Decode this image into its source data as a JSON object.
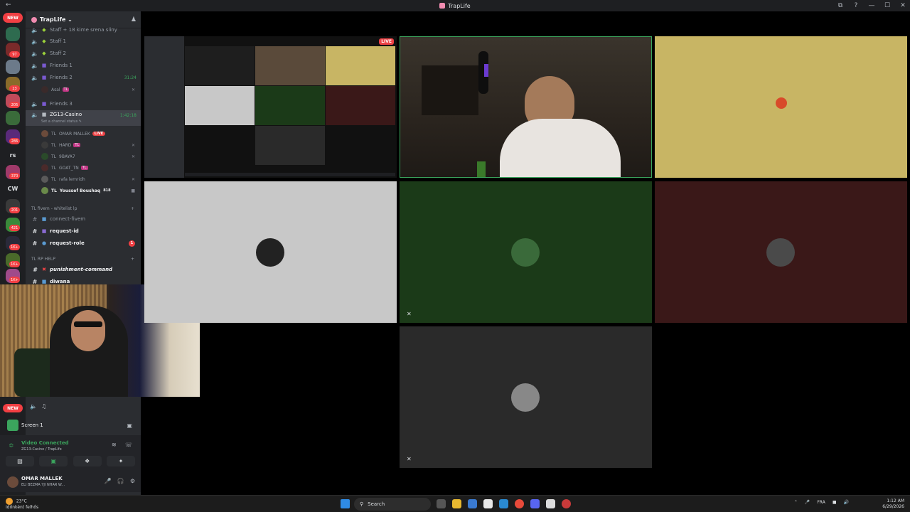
{
  "window": {
    "title": "TrapLife",
    "back": "←",
    "controls": [
      "⧉",
      "?",
      "—",
      "☐",
      "✕"
    ]
  },
  "rail": {
    "new_badge": "NEW",
    "counts": [
      "97",
      "23",
      "205",
      "286",
      "370",
      "201",
      "421",
      "1K+",
      "1K+",
      "1K+"
    ],
    "text_servers": [
      "rs",
      "CW"
    ],
    "new_badge_2": "NEW"
  },
  "server": {
    "name": "TrapLife ⌄",
    "invite_icon": "add-member-icon"
  },
  "channels": [
    {
      "label": "Staff + 18 kime srena sliny",
      "icon": "speaker-icon",
      "right": ""
    },
    {
      "label": "Staff 1",
      "icon": "speaker-icon",
      "right": ""
    },
    {
      "label": "Staff 2",
      "icon": "speaker-icon",
      "right": ""
    },
    {
      "label": "Friends 1",
      "icon": "speaker-icon",
      "right": ""
    },
    {
      "label": "Friends 2",
      "icon": "speaker-icon",
      "right": "31:24"
    }
  ],
  "friends2_user": {
    "name": "Asal",
    "tag": "TL"
  },
  "friends3": {
    "label": "Friends 3"
  },
  "active_channel": {
    "label": "ZG13-Casino",
    "time": "1:42:18",
    "status": "Set a channel status ✎"
  },
  "voice_users": [
    {
      "prefix": "TL",
      "name": "OMAR MALLEK",
      "live": "LIVE"
    },
    {
      "prefix": "TL",
      "name": "HARD",
      "tag": "TL"
    },
    {
      "prefix": "TL",
      "name": "9BAYA7",
      "tag": ""
    },
    {
      "prefix": "TL",
      "name": "GOAT_TN",
      "tag": "TL"
    },
    {
      "prefix": "TL",
      "name": "rafa lemridh",
      "tag": ""
    },
    {
      "prefix": "TL",
      "name": "Youssef Boushaq",
      "tag": "818"
    }
  ],
  "categories": [
    {
      "label": "TL fivem - whitelist lp",
      "plus": "+"
    },
    {
      "label": "TL RP HELP",
      "plus": "+"
    }
  ],
  "text_channels": [
    {
      "label": "connect-fivem"
    },
    {
      "label": "request-id"
    },
    {
      "label": "request-role",
      "badge": "1"
    }
  ],
  "help_channels": [
    {
      "label": "punishment-command"
    },
    {
      "label": "diwana"
    }
  ],
  "voice_panel": {
    "screen_label": "Screen 1",
    "connected": "Video Connected",
    "location": "ZG13-Casino / TrapLife",
    "user_name": "OMAR MALLEK",
    "user_status": "ELI BEZMA YJI NHAR W..."
  },
  "grid": {
    "live_label": "LIVE",
    "tiles": [
      {
        "name": "stream",
        "bg": "#111111"
      },
      {
        "name": "camera-omar",
        "bg": "#2a241e"
      },
      {
        "name": "tile-yellow",
        "bg": "#c8b564"
      },
      {
        "name": "tile-lightgray",
        "bg": "#c8c8c8"
      },
      {
        "name": "tile-darkgreen",
        "bg": "#1b3a18"
      },
      {
        "name": "tile-darkred",
        "bg": "#3a1818"
      },
      {
        "name": "tile-gray",
        "bg": "#2a2a2a"
      }
    ]
  },
  "taskbar": {
    "temp": "23°C",
    "weather": "Időnként felhős",
    "search": "Search",
    "lang": "FRA",
    "time": "1:12 AM",
    "date": "6/29/2026"
  }
}
